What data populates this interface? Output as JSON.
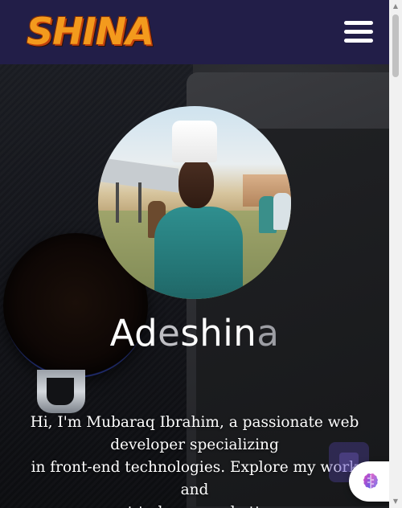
{
  "header": {
    "logo_text": "SHINA",
    "menu_icon": "hamburger-menu-icon"
  },
  "hero": {
    "name_parts": [
      "Ad",
      "e",
      "shin",
      "a"
    ],
    "intro_lines": [
      "Hi, I'm Mubaraq Ibrahim, a passionate web",
      "developer specializing",
      "in front-end technologies. Explore my work and",
      "get to know me better."
    ]
  },
  "floating_widget": {
    "icon": "brain-icon"
  },
  "colors": {
    "navbar_bg": "#221e48",
    "logo_orange": "#f39a1d",
    "text_white": "#ffffff"
  }
}
